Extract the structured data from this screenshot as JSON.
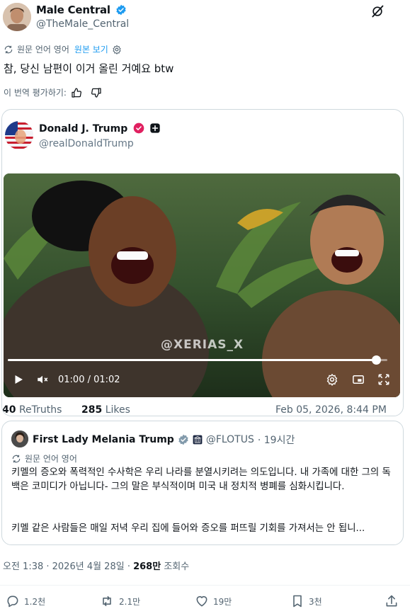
{
  "author": {
    "name": "Male Central",
    "handle": "@TheMale_Central",
    "verified": true
  },
  "translation": {
    "original_lang_label": "원문 언어 영어",
    "show_original": "원본 보기",
    "rate_label": "이 번역 평가하기:"
  },
  "tweet": {
    "text": "참, 당신 남편이 이거 올린 거예요 btw"
  },
  "quoted_post": {
    "name": "Donald J. Trump",
    "handle": "@realDonaldTrump",
    "video": {
      "watermark": "@XERIAS_X",
      "time": "01:00 / 01:02",
      "progress": 0.97
    },
    "stats": {
      "retruths": "40",
      "retruths_label": "ReTruths",
      "likes": "285",
      "likes_label": "Likes",
      "date": "Feb 05, 2026, 8:44 PM"
    }
  },
  "second_quote": {
    "name": "First Lady Melania Trump",
    "handle": "@FLOTUS",
    "time": "· 19시간",
    "original_lang_label": "원문 언어 영어",
    "paragraph1": "키멜의 증오와 폭력적인 수사학은 우리 나라를 분열시키려는 의도입니다. 내 가족에 대한 그의 독백은 코미디가 아닙니다- 그의 말은 부식적이며 미국 내 정치적 병폐를 심화시킵니다.",
    "paragraph2": "키멜 같은 사람들은 매일 저녁 우리 집에 들어와 증오를 퍼뜨릴 기회를 가져서는 안 됩니..."
  },
  "meta": {
    "timestamp": "오전 1:38 · 2026년 4월 28일 · ",
    "views": "268만",
    "views_label": " 조회수"
  },
  "actions": {
    "replies": "1.2천",
    "reposts": "2.1만",
    "likes": "19만",
    "bookmarks": "3천"
  },
  "colors": {
    "accent": "#1d9bf0",
    "text": "#0f1419",
    "muted": "#536471",
    "border": "#cfd9de"
  },
  "icons": [
    "grok-icon",
    "translate-icon",
    "settings-icon",
    "thumbs-up-icon",
    "thumbs-down-icon",
    "verified-badge-icon",
    "play-icon",
    "mute-icon",
    "gear-icon",
    "captions-icon",
    "fullscreen-icon",
    "reply-icon",
    "repost-icon",
    "like-icon",
    "bookmark-icon",
    "share-icon"
  ]
}
